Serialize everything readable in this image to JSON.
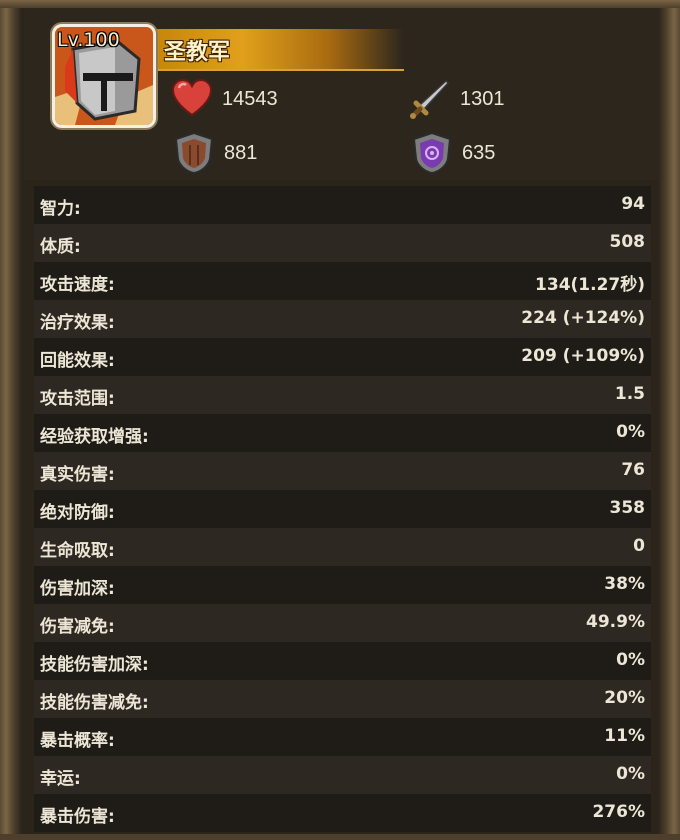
{
  "hero": {
    "level": "Lv.100",
    "name": "圣教军",
    "portrait_icon": "crusader-helmet-portrait"
  },
  "summary_stats": {
    "health": {
      "icon": "heart-icon",
      "value": "14543"
    },
    "attack": {
      "icon": "sword-icon",
      "value": "1301"
    },
    "armor": {
      "icon": "armor-shield-icon",
      "value": "881"
    },
    "magic_resist": {
      "icon": "magic-shield-icon",
      "value": "635"
    }
  },
  "attributes": [
    {
      "label": "智力:",
      "value": "94"
    },
    {
      "label": "体质:",
      "value": "508"
    },
    {
      "label": "攻击速度:",
      "value": "134(1.27秒)"
    },
    {
      "label": "治疗效果:",
      "value": "224 (+124%)"
    },
    {
      "label": "回能效果:",
      "value": "209 (+109%)"
    },
    {
      "label": "攻击范围:",
      "value": "1.5"
    },
    {
      "label": "经验获取增强:",
      "value": "0%"
    },
    {
      "label": "真实伤害:",
      "value": "76"
    },
    {
      "label": "绝对防御:",
      "value": "358"
    },
    {
      "label": "生命吸取:",
      "value": "0"
    },
    {
      "label": "伤害加深:",
      "value": "38%"
    },
    {
      "label": "伤害减免:",
      "value": "49.9%"
    },
    {
      "label": "技能伤害加深:",
      "value": "0%"
    },
    {
      "label": "技能伤害减免:",
      "value": "20%"
    },
    {
      "label": "暴击概率:",
      "value": "11%"
    },
    {
      "label": "幸运:",
      "value": "0%"
    },
    {
      "label": "暴击伤害:",
      "value": "276%"
    }
  ],
  "colors": {
    "frame": "#2b241b",
    "row_dark": "#1f1b16",
    "row_light": "#2d2821",
    "text": "#ece6d6",
    "banner": "#e0a01c"
  }
}
